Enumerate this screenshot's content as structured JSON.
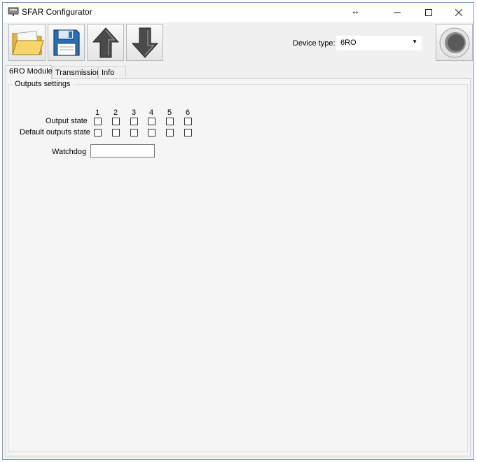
{
  "window": {
    "title": "SFAR Configurator"
  },
  "titlebar": {
    "move_glyph": "↔",
    "minimize_glyph": "—",
    "maximize_glyph": "☐",
    "close_glyph": "✕"
  },
  "toolbar": {
    "open_icon": "open-folder-icon",
    "save_icon": "floppy-disk-icon",
    "upload_icon": "arrow-up-icon",
    "download_icon": "arrow-down-icon",
    "device_type_label": "Device type:",
    "device_type_value": "6RO",
    "connect_icon": "connect-button-icon"
  },
  "tabs": [
    {
      "label": "6RO Module",
      "active": true
    },
    {
      "label": "Transmission",
      "active": false
    },
    {
      "label": "Info",
      "active": false
    }
  ],
  "outputs": {
    "group_title": "Outputs settings",
    "columns": [
      "1",
      "2",
      "3",
      "4",
      "5",
      "6"
    ],
    "rows": [
      {
        "label": "Output state",
        "checked": [
          false,
          false,
          false,
          false,
          false,
          false
        ]
      },
      {
        "label": "Default outputs state",
        "checked": [
          false,
          false,
          false,
          false,
          false,
          false
        ]
      }
    ],
    "watchdog_label": "Watchdog",
    "watchdog_value": ""
  },
  "colors": {
    "window_bg": "#f0f0f0",
    "panel_bg": "#f5f5f5",
    "folder": "#f2c94c",
    "floppy": "#2a6fb5",
    "arrow": "#4a4a4a"
  }
}
